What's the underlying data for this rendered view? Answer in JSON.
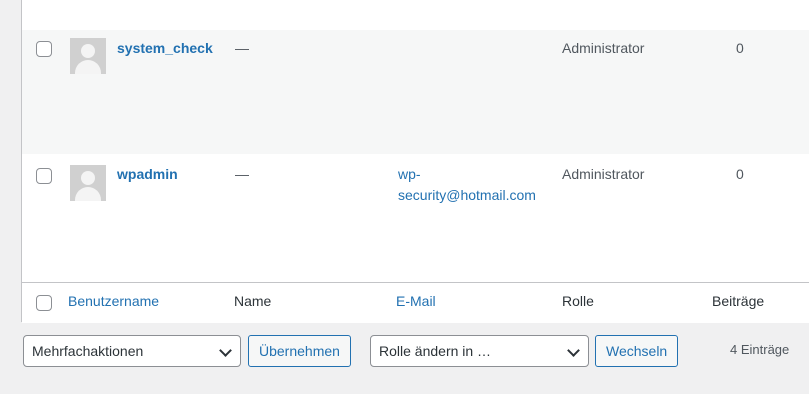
{
  "users": [
    {
      "username": "system_check",
      "name": "—",
      "email": "",
      "role": "Administrator",
      "posts": "0"
    },
    {
      "username": "wpadmin",
      "name": "—",
      "email_line1": "wp-",
      "email_line2": "security@hotmail.com",
      "role": "Administrator",
      "posts": "0"
    }
  ],
  "footer": {
    "username_label": "Benutzername",
    "name_label": "Name",
    "email_label": "E-Mail",
    "role_label": "Rolle",
    "posts_label": "Beiträge"
  },
  "bulk": {
    "actions_label": "Mehrfachaktionen",
    "apply_label": "Übernehmen",
    "role_change_label": "Rolle ändern in …",
    "change_label": "Wechseln",
    "count_label": "4 Einträge"
  }
}
